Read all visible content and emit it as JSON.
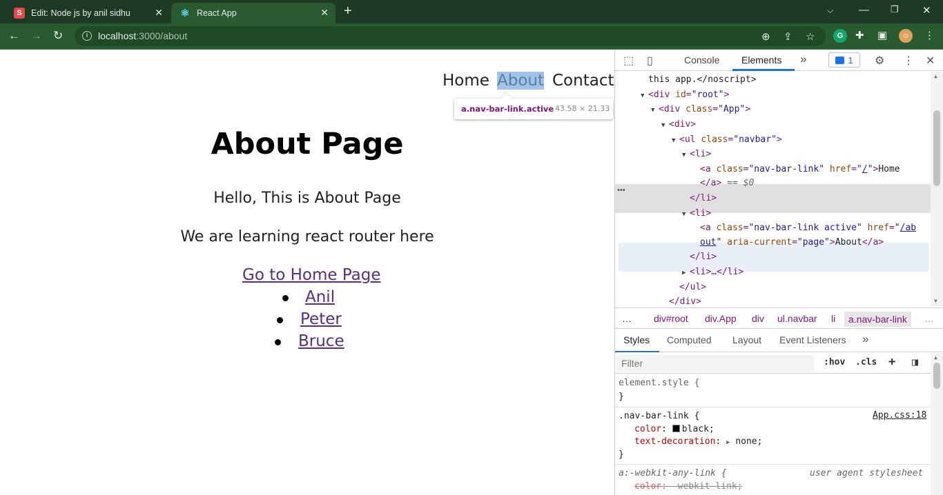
{
  "browser": {
    "tabs": [
      {
        "title": "Edit: Node js by anil sidhu",
        "favicon": "S"
      },
      {
        "title": "React App",
        "favicon": "⚛"
      }
    ],
    "url_host": "localhost",
    "url_path": ":3000/about",
    "new_tab": "+",
    "extension_g": "G"
  },
  "page": {
    "nav": [
      "Home",
      "About",
      "Contact"
    ],
    "tooltip": {
      "selector": "a.nav-bar-link.active",
      "dims": "43.58 × 21.33"
    },
    "heading": "About Page",
    "para1": "Hello, This is About Page",
    "para2": "We are learning react router here",
    "home_link": "Go to Home Page",
    "list": [
      "Anil",
      "Peter",
      "Bruce"
    ]
  },
  "devtools": {
    "tabs": [
      "Console",
      "Elements"
    ],
    "more": "»",
    "badge": "1",
    "tree": {
      "l1": "this app.</noscript>",
      "l2_tag": "<div ",
      "l2_attr": "id",
      "l2_val": "\"root\"",
      "l2_end": ">",
      "l3_tag": "<div ",
      "l3_attr": "class",
      "l3_val": "\"App\"",
      "l3_end": ">",
      "l4": "<div>",
      "l5_tag": "<ul ",
      "l5_attr": "class",
      "l5_val": "\"navbar\"",
      "l5_end": ">",
      "l6": "<li>",
      "l7_tag": "<a ",
      "l7_attr1": "class",
      "l7_val1": "\"nav-bar-link\"",
      "l7_attr2": " href",
      "l7_val2a": "\"",
      "l7_link": "/",
      "l7_val2b": "\"",
      "l7_end": ">",
      "l7_text": "Home",
      "l8": "</a>",
      "l8_eq": " == $0",
      "l9": "</li>",
      "l10": "<li>",
      "l11_tag": "<a ",
      "l11_attr1": "class",
      "l11_val1": "\"nav-bar-link active\"",
      "l11_attr2": " href",
      "l11_val2a": "\"",
      "l11_link": "/ab",
      "l12_link": "out",
      "l12_val": "\"",
      "l12_attr": " aria-current",
      "l12_val2": "\"page\"",
      "l12_end": ">",
      "l12_text": "About",
      "l12_close": "</a>",
      "l13": "</li>",
      "l14": "<li>…</li>",
      "l15": "</ul>",
      "l16": "</div>"
    },
    "crumbs": [
      "…",
      "div#root",
      "div.App",
      "div",
      "ul.navbar",
      "li",
      "a.nav-bar-link",
      "…"
    ],
    "style_tabs": [
      "Styles",
      "Computed",
      "Layout",
      "Event Listeners"
    ],
    "filter_placeholder": "Filter",
    "hov": ":hov",
    "cls": ".cls",
    "styles": {
      "element_style": "element.style {",
      "close": "}",
      "rule_selector": ".nav-bar-link {",
      "rule_source": "App.css:18",
      "prop1": "color",
      "prop1_val": "black;",
      "prop2": "text-decoration",
      "prop2_val": "none;",
      "ua_selector": "a:-webkit-any-link {",
      "ua_source": "user agent stylesheet",
      "ua_prop": "color",
      "ua_val": "-webkit-link;"
    }
  },
  "colors": {
    "tabbar": "#1f3a24",
    "toolbar": "#2a5a30",
    "link_visited": "#5a2d82",
    "nav_highlight": "#9fc4e7",
    "devtools_accent": "#1a73e8"
  }
}
